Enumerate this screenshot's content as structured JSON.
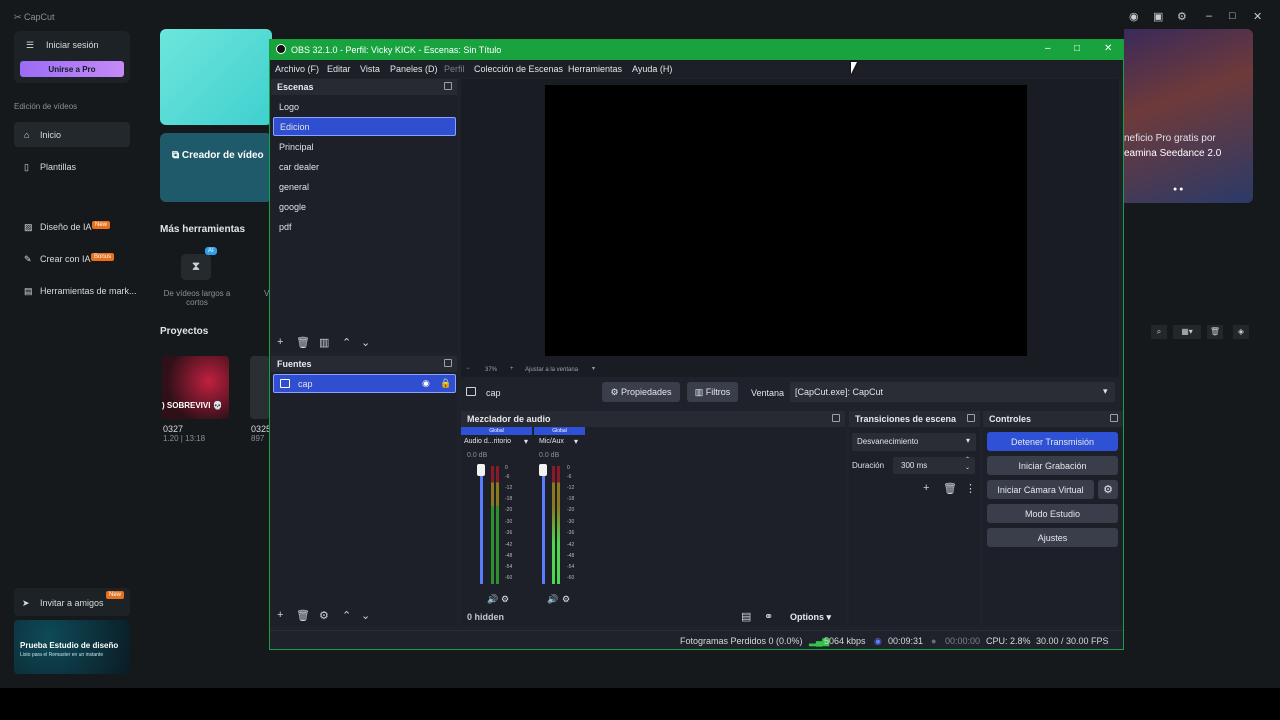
{
  "capcut": {
    "app_name": "CapCut",
    "login": "Iniciar sesión",
    "join_pro": "Unirse a Pro",
    "section_video": "Edición de vídeos",
    "nav_home": "Inicio",
    "nav_templates": "Plantillas",
    "nav_ai_design": "Diseño de IA",
    "nav_ai_design_badge": "New",
    "nav_create_ai": "Crear con IA",
    "nav_create_ai_badge": "Bonus",
    "nav_marketing": "Herramientas de mark...",
    "invite": "Invitar a amigos",
    "invite_badge": "New",
    "promo_title": "Prueba Estudio de diseño",
    "promo_sub": "Listo para el Remaster en un instante",
    "card_video_creator": "Creador de vídeo",
    "more_tools": "Más herramientas",
    "tool_ai_badge": "AI",
    "tool_long_short": "De vídeos largos a cortos",
    "tool_v": "V",
    "projects": "Proyectos",
    "project1_name": "0327",
    "project1_meta": "1.20 | 13:18",
    "project1_thumb_text": ") SOBREVIVI 💀",
    "project2_name": "0325",
    "project2_meta": "897",
    "banner_text1": "neficio Pro gratis por",
    "banner_text2": "eamina Seedance 2.0"
  },
  "obs": {
    "title": "OBS 32.1.0 - Perfil: Vicky KICK - Escenas: Sin Título",
    "menu": [
      "Archivo (F)",
      "Editar",
      "Vista",
      "Paneles (D)",
      "Perfil",
      "Colección de Escenas",
      "Herramientas",
      "Ayuda (H)"
    ],
    "scenes_header": "Escenas",
    "scenes": [
      "Logo",
      "Edicion",
      "Principal",
      "car dealer",
      "general",
      "google",
      "pdf"
    ],
    "sources_header": "Fuentes",
    "sources": [
      "cap"
    ],
    "zoom_label": "37%",
    "fit_label": "Ajustar a la ventana",
    "selected_source": "cap",
    "properties_btn": "Propiedades",
    "filters_btn": "Filtros",
    "window_label": "Ventana",
    "window_value": "[CapCut.exe]: CapCut",
    "mixer_header": "Mezclador de audio",
    "channels": [
      {
        "global": "Global",
        "name": "Audio d...ritorio",
        "db": "0.0 dB"
      },
      {
        "global": "Global",
        "name": "Mic/Aux",
        "db": "0.0 dB"
      }
    ],
    "meter_ticks": [
      "0",
      "-6",
      "-12",
      "-18",
      "-20",
      "-30",
      "-36",
      "-42",
      "-48",
      "-54",
      "-60"
    ],
    "hidden_label": "0 hidden",
    "options_label": "Options",
    "transitions_header": "Transiciones de escena",
    "transition_value": "Desvanecimiento",
    "duration_label": "Duración",
    "duration_value": "300 ms",
    "controls_header": "Controles",
    "controls": {
      "stop_stream": "Detener Transmisión",
      "start_record": "Iniciar Grabación",
      "virtual_cam": "Iniciar Cámara Virtual",
      "studio_mode": "Modo Estudio",
      "settings": "Ajustes"
    },
    "status": {
      "dropped": "Fotogramas Perdidos 0 (0.0%)",
      "bitrate": "5064 kbps",
      "stream_time": "00:09:31",
      "rec_time": "00:00:00",
      "cpu": "CPU: 2.8%",
      "fps": "30.00 / 30.00 FPS"
    },
    "colors": {
      "titlebar": "#18a33e",
      "accent": "#2e51d6",
      "bg": "#1f222a"
    }
  }
}
